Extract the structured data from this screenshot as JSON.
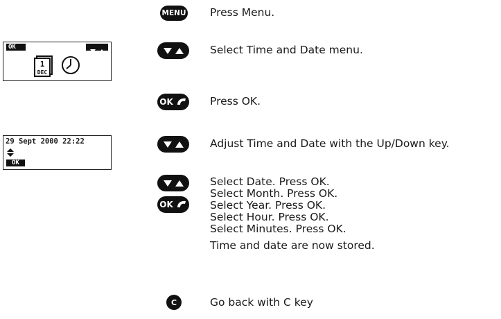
{
  "steps": {
    "s1": "Press Menu.",
    "s2": "Select Time and Date menu.",
    "s3": "Press OK.",
    "s4": "Adjust Time and Date with the Up/Down key.",
    "s5": [
      "Select Date. Press OK.",
      "Select Month. Press OK.",
      "Select Year. Press OK.",
      "Select Hour. Press OK.",
      "Select Minutes. Press OK."
    ],
    "s6": "Time and date are now stored.",
    "s7": "Go back with C key"
  },
  "keys": {
    "menu": "MENU",
    "ok": "OK",
    "c": "C"
  },
  "screens": {
    "menu_screen": {
      "softkey": "OK",
      "calendar_day": "1",
      "calendar_month": "DEC"
    },
    "datetime_screen": {
      "datetime": "29 Sept 2000 22:22",
      "softkey": "OK"
    }
  },
  "icons": [
    "menu-key-icon",
    "up-down-key-icon",
    "ok-call-key-icon",
    "calendar-icon",
    "clock-icon",
    "up-down-arrow-icon",
    "c-key-icon"
  ]
}
